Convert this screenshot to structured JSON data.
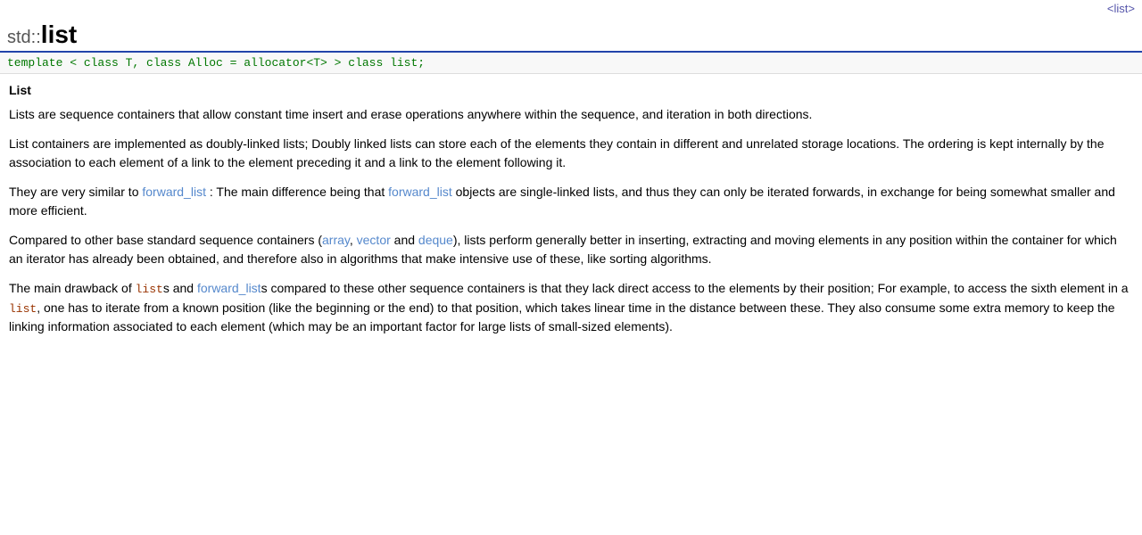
{
  "topnav": {
    "link_label": "<list>"
  },
  "header": {
    "prefix": "std::",
    "title": "list"
  },
  "template_line": "template < class T, class Alloc = allocator<T> > class list;",
  "section": {
    "title": "List",
    "paragraphs": [
      "Lists are sequence containers that allow constant time insert and erase operations anywhere within the sequence, and iteration in both directions.",
      "List containers are implemented as doubly-linked lists; Doubly linked lists can store each of the elements they contain in different and unrelated storage locations. The ordering is kept internally by the association to each element of a link to the element preceding it and a link to the element following it.",
      null,
      null,
      null,
      null
    ],
    "para_forward_list_1": "They are very similar to",
    "para_forward_list_1_link1": "forward_list",
    "para_forward_list_1_mid": ": The main difference being that",
    "para_forward_list_1_link2": "forward_list",
    "para_forward_list_1_end": "objects are single-linked lists, and thus they can only be iterated forwards, in exchange for being somewhat smaller and more efficient.",
    "para_compare_start": "Compared to other base standard sequence containers (",
    "para_compare_link1": "array",
    "para_compare_comma1": ", ",
    "para_compare_link2": "vector",
    "para_compare_and": " and ",
    "para_compare_link3": "deque",
    "para_compare_end": "), lists perform generally better in inserting, extracting and moving elements in any position within the container for which an iterator has already been obtained, and therefore also in algorithms that make intensive use of these, like sorting algorithms.",
    "para_drawback_start": "The main drawback of ",
    "para_drawback_code1": "list",
    "para_drawback_mid1": "s and ",
    "para_drawback_link1": "forward_list",
    "para_drawback_mid2": "s compared to these other sequence containers is that they lack direct access to the elements by their position; For example, to access the sixth element in a ",
    "para_drawback_code2": "list",
    "para_drawback_mid3": ", one has to iterate from a known position (like the beginning or the end) to that position, which takes linear time in the distance between these. They also consume some extra memory to keep the linking information associated to each element (which may be an important factor for large lists of small-sized elements)."
  }
}
